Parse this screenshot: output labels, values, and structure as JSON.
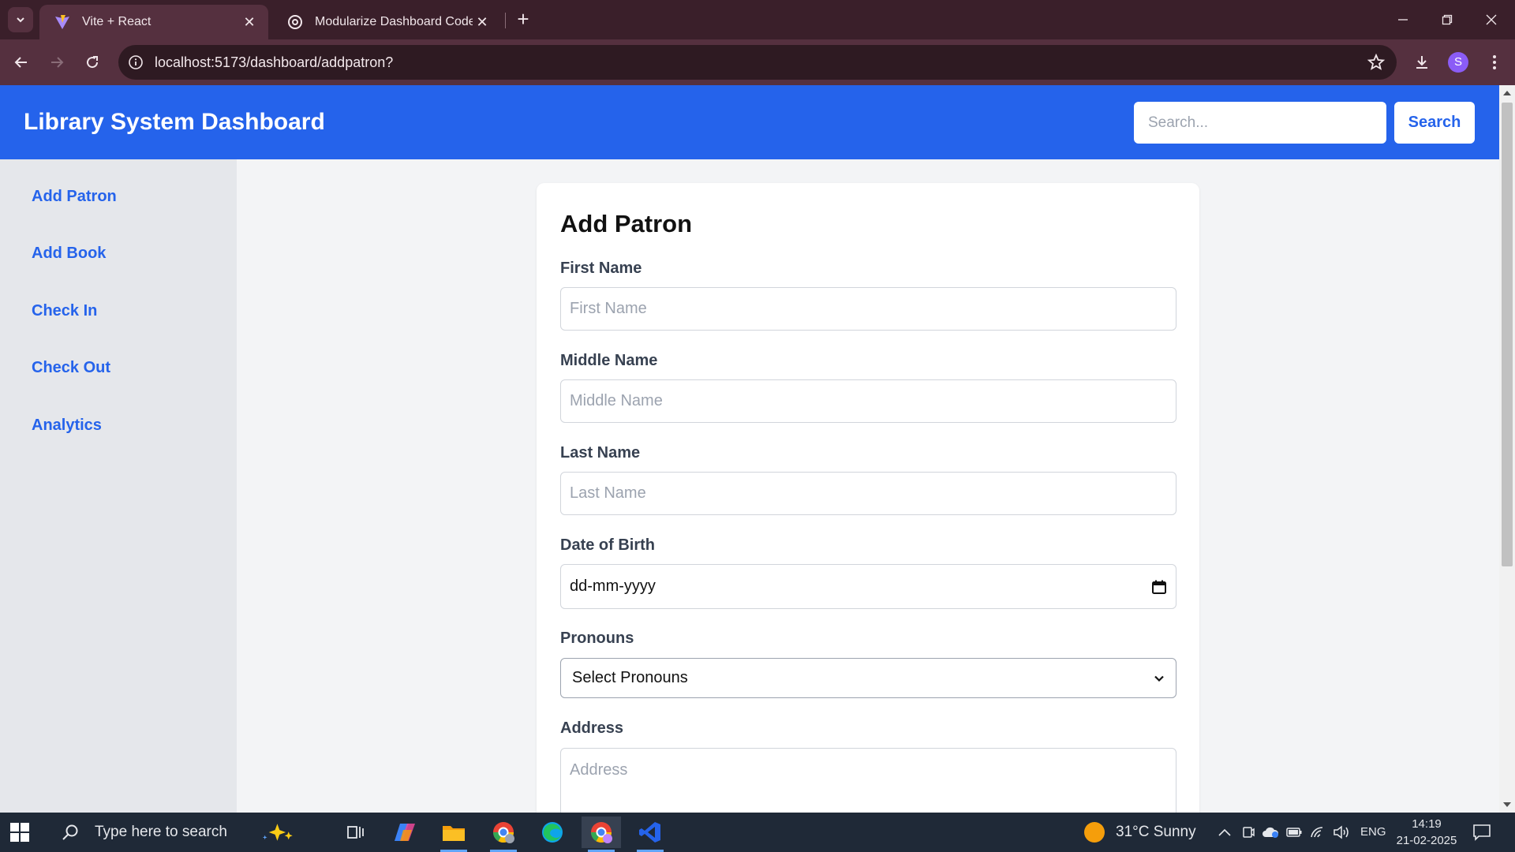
{
  "browser": {
    "tabs": [
      {
        "title": "Vite + React",
        "active": true
      },
      {
        "title": "Modularize Dashboard Code",
        "active": false
      }
    ],
    "url": "localhost:5173/dashboard/addpatron?",
    "profile_initial": "S"
  },
  "header": {
    "title": "Library System Dashboard",
    "search_placeholder": "Search...",
    "search_button": "Search",
    "color": "#2563eb"
  },
  "sidebar": {
    "items": [
      {
        "label": "Add Patron"
      },
      {
        "label": "Add Book"
      },
      {
        "label": "Check In"
      },
      {
        "label": "Check Out"
      },
      {
        "label": "Analytics"
      }
    ]
  },
  "form": {
    "title": "Add Patron",
    "first_name": {
      "label": "First Name",
      "placeholder": "First Name"
    },
    "middle_name": {
      "label": "Middle Name",
      "placeholder": "Middle Name"
    },
    "last_name": {
      "label": "Last Name",
      "placeholder": "Last Name"
    },
    "dob": {
      "label": "Date of Birth",
      "value": "dd-mm-yyyy"
    },
    "pronouns": {
      "label": "Pronouns",
      "value": "Select Pronouns"
    },
    "address": {
      "label": "Address",
      "placeholder": "Address"
    }
  },
  "taskbar": {
    "search_placeholder": "Type here to search",
    "weather": "31°C  Sunny",
    "language": "ENG",
    "time": "14:19",
    "date": "21-02-2025"
  }
}
